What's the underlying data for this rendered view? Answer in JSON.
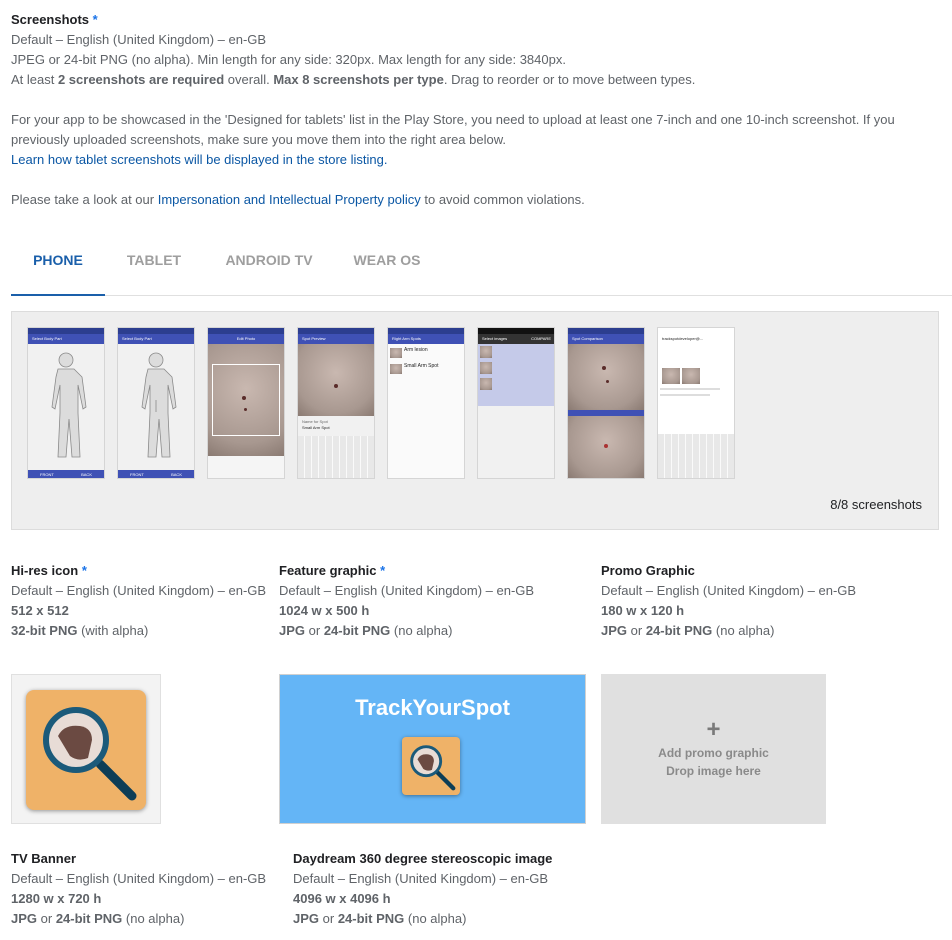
{
  "screenshots": {
    "title": "Screenshots",
    "required_mark": "*",
    "language": "Default – English (United Kingdom) – en-GB",
    "format_line": "JPEG or 24-bit PNG (no alpha). Min length for any side: 320px. Max length for any side: 3840px.",
    "req_prefix": "At least ",
    "req_bold1": "2 screenshots are required",
    "req_mid": " overall. ",
    "req_bold2": "Max 8 screenshots per type",
    "req_suffix": ". Drag to reorder or to move between types.",
    "tablet_line1": "For your app to be showcased in the 'Designed for tablets' list in the Play Store, you need to upload at least one 7-inch and one 10-inch screenshot. If you",
    "tablet_line2": "previously uploaded screenshots, make sure you move them into the right area below.",
    "tablet_link": "Learn how tablet screenshots will be displayed in the store listing.",
    "policy_prefix": "Please take a look at our ",
    "policy_link": "Impersonation and Intellectual Property policy",
    "policy_suffix": " to avoid common violations."
  },
  "tabs": [
    {
      "label": "PHONE",
      "active": true
    },
    {
      "label": "TABLET",
      "active": false
    },
    {
      "label": "ANDROID TV",
      "active": false
    },
    {
      "label": "WEAR OS",
      "active": false
    }
  ],
  "gallery": {
    "count_label": "8/8 screenshots",
    "shots": [
      {
        "bar": "Select Body Part",
        "bottom_left": "FRONT",
        "bottom_right": "BACK"
      },
      {
        "bar": "Select Body Part",
        "bottom_left": "FRONT",
        "bottom_right": "BACK"
      },
      {
        "bar": "Edit Photo"
      },
      {
        "bar": "Spot Preview",
        "name_label": "Name for Spot",
        "name_value": "Small Arm Spot"
      },
      {
        "bar": "Right Arm Spots",
        "items": [
          "Arm lesion",
          "Small Arm Spot"
        ]
      },
      {
        "bar": "Select images",
        "action": "COMPARE"
      },
      {
        "bar": "Spot Comparison"
      },
      {
        "bar": "trackspotdeveloper@..."
      }
    ]
  },
  "assets": {
    "hires": {
      "title": "Hi-res icon",
      "required_mark": "*",
      "language": "Default – English (United Kingdom) – en-GB",
      "size": "512 x 512",
      "fmt_bold": "32-bit PNG",
      "fmt_rest": " (with alpha)"
    },
    "feature": {
      "title": "Feature graphic",
      "required_mark": "*",
      "language": "Default – English (United Kingdom) – en-GB",
      "size": "1024 w x 500 h",
      "fmt_bold1": "JPG",
      "fmt_or": " or ",
      "fmt_bold2": "24-bit PNG",
      "fmt_rest": " (no alpha)",
      "app_name": "TrackYourSpot"
    },
    "promo": {
      "title": "Promo Graphic",
      "language": "Default – English (United Kingdom) – en-GB",
      "size": "180 w x 120 h",
      "fmt_bold1": "JPG",
      "fmt_or": " or ",
      "fmt_bold2": "24-bit PNG",
      "fmt_rest": " (no alpha)",
      "plus": "+",
      "add_label": "Add promo graphic",
      "drop_label": "Drop image here"
    },
    "tv": {
      "title": "TV Banner",
      "language": "Default – English (United Kingdom) – en-GB",
      "size": "1280 w x 720 h",
      "fmt_bold1": "JPG",
      "fmt_or": " or ",
      "fmt_bold2": "24-bit PNG",
      "fmt_rest": " (no alpha)"
    },
    "daydream": {
      "title": "Daydream 360 degree stereoscopic image",
      "language": "Default – English (United Kingdom) – en-GB",
      "size": "4096 w x 4096 h",
      "fmt_bold1": "JPG",
      "fmt_or": " or ",
      "fmt_bold2": "24-bit PNG",
      "fmt_rest": " (no alpha)"
    }
  },
  "colors": {
    "accent": "#1a5faa",
    "feature_bg": "#64b5f6",
    "icon_bg": "#efb268",
    "app_bar": "#3f51b5"
  }
}
